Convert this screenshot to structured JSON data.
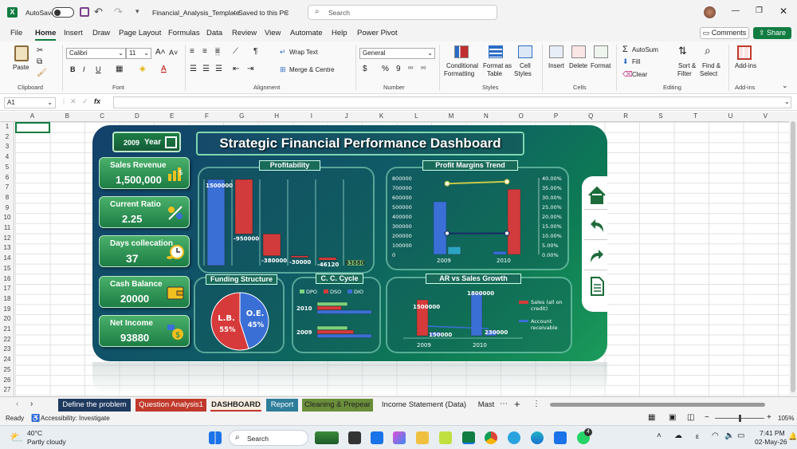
{
  "titlebar": {
    "autosave_label": "AutoSave",
    "autosave_state": "Off",
    "filename": "Financial_Analysis_Template",
    "save_status": "Saved to this PC",
    "search_placeholder": "Search"
  },
  "ribbon_tabs": [
    "File",
    "Home",
    "Insert",
    "Draw",
    "Page Layout",
    "Formulas",
    "Data",
    "Review",
    "View",
    "Automate",
    "Help",
    "Power Pivot"
  ],
  "ribbon_actions": {
    "comments": "Comments",
    "share": "Share"
  },
  "clipboard": {
    "paste": "Paste",
    "group": "Clipboard"
  },
  "font": {
    "name": "Calibri",
    "size": "11",
    "group": "Font"
  },
  "alignment": {
    "wrap": "Wrap Text",
    "merge": "Merge & Centre",
    "group": "Alignment"
  },
  "number": {
    "format": "General",
    "group": "Number"
  },
  "styles": {
    "conditional": "Conditional",
    "conditional2": "Formatting",
    "format_as": "Format as",
    "format_as2": "Table",
    "cell": "Cell",
    "cell2": "Styles",
    "group": "Styles"
  },
  "cells": {
    "insert": "Insert",
    "delete": "Delete",
    "format": "Format",
    "group": "Cells"
  },
  "editing": {
    "autosum": "AutoSum",
    "fill": "Fill",
    "clear": "Clear",
    "sort": "Sort &",
    "sort2": "Filter",
    "find": "Find &",
    "find2": "Select",
    "group": "Editing"
  },
  "addins": {
    "label": "Add-ins",
    "group": "Add-ins"
  },
  "formula_bar": {
    "cell_ref": "A1",
    "fx": "fx",
    "value": ""
  },
  "columns": [
    "A",
    "B",
    "C",
    "D",
    "E",
    "F",
    "G",
    "H",
    "I",
    "J",
    "K",
    "L",
    "M",
    "N",
    "O",
    "P",
    "Q",
    "R",
    "S",
    "T",
    "U",
    "V"
  ],
  "rows": [
    "1",
    "2",
    "3",
    "4",
    "5",
    "6",
    "7",
    "8",
    "9",
    "10",
    "11",
    "12",
    "13",
    "14",
    "15",
    "16",
    "17",
    "18",
    "19",
    "20",
    "21",
    "22",
    "23",
    "24",
    "25",
    "26",
    "27"
  ],
  "dashboard": {
    "title": "Strategic Financial Performance Dashboard",
    "year_value": "2009",
    "year_label": "Year",
    "kpis": [
      {
        "label": "Sales Revenue",
        "value": "1,500,000",
        "icon": "money-chart-icon"
      },
      {
        "label": "Current Ratio",
        "value": "2.25",
        "icon": "ratio-icon"
      },
      {
        "label": "Days collecation",
        "value": "37",
        "icon": "clock-coins-icon"
      },
      {
        "label": "Cash Balance",
        "value": "20000",
        "icon": "wallet-icon"
      },
      {
        "label": "Net Income",
        "value": "93880",
        "icon": "income-icon"
      }
    ],
    "nav_icons": [
      "home-icon",
      "back-arrow-icon",
      "forward-arrow-icon",
      "document-icon"
    ],
    "colors": {
      "blue": "#3a6fd6",
      "red": "#d23b3b",
      "gold": "#c8c84a",
      "green_light": "#7cd27c"
    }
  },
  "chart_data": [
    {
      "type": "bar",
      "title": "Profitability",
      "categories": [
        "",
        "",
        "",
        "",
        "",
        ""
      ],
      "values": [
        1500000,
        -950000,
        -380000,
        -30000,
        -46120,
        93880
      ],
      "labels": [
        "1500000",
        "-950000",
        "-380000",
        "-30000",
        "-46120",
        "93880"
      ]
    },
    {
      "type": "bar",
      "title": "Profit Margins Trend",
      "categories": [
        "2009",
        "2010"
      ],
      "left_ticks": [
        "800000",
        "700000",
        "600000",
        "500000",
        "400000",
        "300000",
        "200000",
        "100000",
        "0"
      ],
      "right_ticks": [
        "40.00%",
        "35.00%",
        "30.00%",
        "25.00%",
        "20.00%",
        "15.00%",
        "10.00%",
        "5.00%",
        "0.00%"
      ],
      "series": [
        {
          "values": [
            550000,
            30000
          ]
        },
        {
          "values": [
            80000,
            680000
          ]
        }
      ],
      "lines": [
        {
          "values": [
            0.37,
            0.38
          ]
        },
        {
          "values": [
            0.11,
            0.11
          ]
        }
      ]
    },
    {
      "type": "pie",
      "title": "Funding Structure",
      "slices": [
        {
          "name": "L.B.",
          "value": 55,
          "label": "55%"
        },
        {
          "name": "O.E.",
          "value": 45,
          "label": "45%"
        }
      ]
    },
    {
      "type": "bar",
      "title": "C. C. Cycle",
      "categories": [
        "2010",
        "2009"
      ],
      "series": [
        {
          "name": "DPO",
          "values": [
            40,
            40
          ]
        },
        {
          "name": "DSO",
          "values": [
            32,
            48
          ]
        },
        {
          "name": "DIO",
          "values": [
            72,
            72
          ]
        }
      ]
    },
    {
      "type": "bar",
      "title": "AR vs Sales Growth",
      "categories": [
        "2009",
        "2010"
      ],
      "series": [
        {
          "name": "Sales (all on credit)",
          "values": [
            1500000,
            1800000
          ]
        },
        {
          "name": "Account receivable",
          "values": [
            150000,
            230000
          ]
        }
      ],
      "labels": [
        "1500000",
        "1800000",
        "150000",
        "230000"
      ]
    }
  ],
  "sheet_tabs": [
    {
      "label": "Define the problem",
      "color": "#1f3a5f"
    },
    {
      "label": "Question Analysis1",
      "color": "#c0392b"
    },
    {
      "label": "DASHBOARD",
      "color": "#f3e4d4"
    },
    {
      "label": "Report",
      "color": "#2e7d9a"
    },
    {
      "label": "Cleaning & Prepear",
      "color": "#6a8e3a"
    },
    {
      "label": "Income Statement (Data)",
      "color": "#f3f3f3"
    },
    {
      "label": "Mast",
      "color": "#f3f3f3"
    }
  ],
  "status": {
    "ready": "Ready",
    "accessibility": "Accessibility: Investigate",
    "zoom": "105%"
  },
  "taskbar": {
    "temp": "40°C",
    "weather": "Partly cloudy",
    "search": "Search",
    "time": "7:41 PM",
    "date": "02-May-26",
    "lang": "ε",
    "badge": "4"
  }
}
